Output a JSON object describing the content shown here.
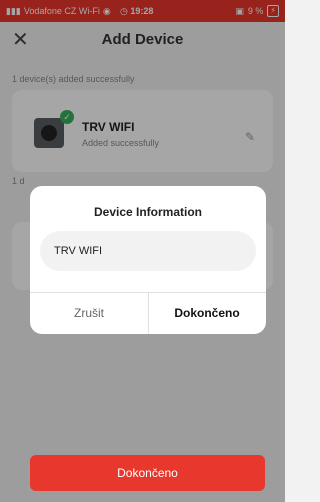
{
  "status_bar": {
    "carrier": "Vodafone CZ Wi-Fi",
    "time": "19:28",
    "battery": "9 %"
  },
  "header": {
    "close_icon": "close-icon",
    "title": "Add Device"
  },
  "success_caption": "1 device(s) added successfully",
  "device": {
    "name": "TRV WIFI",
    "status": "Added successfully",
    "icon": "thermostat-valve-icon"
  },
  "partial_caption": "1 d",
  "dialog": {
    "title": "Device Information",
    "input_value": "TRV WIFI",
    "cancel_label": "Zrušit",
    "done_label": "Dokončeno"
  },
  "bottom_button": {
    "label": "Dokončeno"
  },
  "colors": {
    "accent": "#e8372c",
    "success": "#3bb05c"
  }
}
